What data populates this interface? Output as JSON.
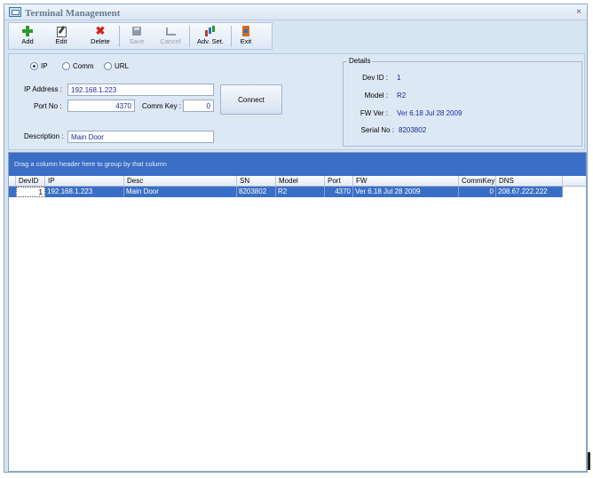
{
  "window": {
    "title": "Terminal Management",
    "close_glyph": "×"
  },
  "toolbar": {
    "buttons": [
      {
        "label": "Add",
        "icon": "add-icon",
        "enabled": true
      },
      {
        "label": "Edit",
        "icon": "edit-icon",
        "enabled": true
      },
      {
        "label": "Delete",
        "icon": "delete-icon",
        "enabled": true
      },
      {
        "label": "Save",
        "icon": "save-icon",
        "enabled": false
      },
      {
        "label": "Cancel",
        "icon": "cancel-icon",
        "enabled": false
      },
      {
        "label": "Adv. Set.",
        "icon": "advanced-settings-icon",
        "enabled": true
      },
      {
        "label": "Exit",
        "icon": "exit-icon",
        "enabled": true
      }
    ],
    "delete_glyph": "✖"
  },
  "connection": {
    "modes": [
      {
        "label": "IP",
        "selected": true
      },
      {
        "label": "Comm",
        "selected": false
      },
      {
        "label": "URL",
        "selected": false
      }
    ],
    "ip_label": "IP Address :",
    "ip_value": "192.168.1.223",
    "port_label": "Port No :",
    "port_value": "4370",
    "commkey_label": "Comm Key :",
    "commkey_value": "0",
    "connect_label": "Connect",
    "description_label": "Description :",
    "description_value": "Main Door"
  },
  "details": {
    "title": "Details",
    "dev_id_label": "Dev ID :",
    "dev_id_value": "1",
    "model_label": "Model :",
    "model_value": "R2",
    "fw_label": "FW Ver :",
    "fw_value": "Ver 6.18 Jul 28 2009",
    "serial_label": "Serial No :",
    "serial_value": "8203802"
  },
  "grid": {
    "group_hint": "Drag a column header here to group by that column",
    "columns": [
      "DevID",
      "IP",
      "Desc",
      "SN",
      "Model",
      "Port",
      "FW",
      "CommKey",
      "DNS"
    ],
    "rows": [
      [
        "1",
        "192.168.1.223",
        "Main Door",
        "8203802",
        "R2",
        "4370",
        "Ver 6.18 Jul 28 2009",
        "0",
        "208.67.222.222"
      ]
    ]
  },
  "colors": {
    "window_bg": "#d7e4f2",
    "group_panel": "#3b6ec5",
    "selected_row": "#3a6fc6",
    "value_text": "#1b2a9c"
  }
}
